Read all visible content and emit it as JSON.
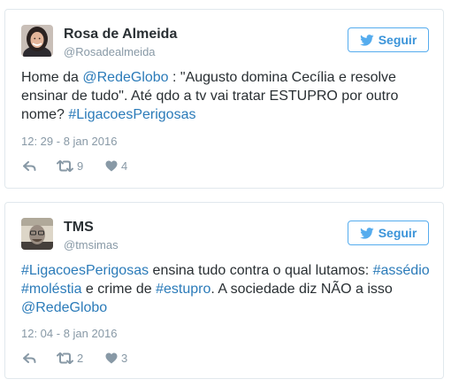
{
  "colors": {
    "link": "#2b7bb9",
    "follow_blue": "#3b94d9",
    "muted": "#8899a6",
    "border": "#e1e8ed"
  },
  "tweets": [
    {
      "display_name": "Rosa de Almeida",
      "handle": "@Rosadealmeida",
      "follow_label": "Seguir",
      "text": {
        "p1": "Home da ",
        "mention1": "@RedeGlobo",
        "p2": " : \"Augusto domina Cecília e resolve ensinar de tudo\". Até qdo a tv vai tratar ESTUPRO por outro nome? ",
        "hashtag1": "#LigacoesPerigosas"
      },
      "timestamp": "12: 29 - 8 jan 2016",
      "retweet_count": "9",
      "like_count": "4",
      "icons": [
        "reply-icon",
        "retweet-icon",
        "heart-icon",
        "twitter-bird-icon"
      ]
    },
    {
      "display_name": "TMS",
      "handle": "@tmsimas",
      "follow_label": "Seguir",
      "text": {
        "hashtag1": "#LigacoesPerigosas",
        "p1": " ensina tudo contra o qual lutamos: ",
        "hashtag2": "#assédio",
        "p2": " ",
        "hashtag3": "#moléstia",
        "p3": " e crime de ",
        "hashtag4": "#estupro",
        "p4": ". A sociedade diz NÃO a isso  ",
        "mention1": "@RedeGlobo"
      },
      "timestamp": "12: 04 - 8 jan 2016",
      "retweet_count": "2",
      "like_count": "3",
      "icons": [
        "reply-icon",
        "retweet-icon",
        "heart-icon",
        "twitter-bird-icon"
      ]
    }
  ]
}
